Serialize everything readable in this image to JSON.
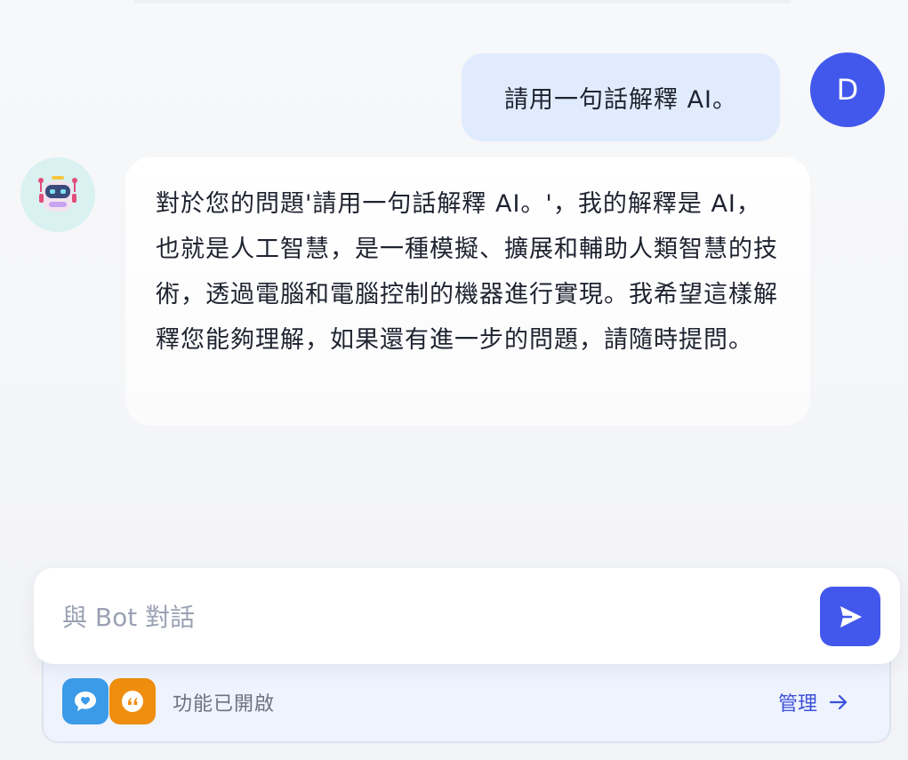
{
  "conversation": {
    "user_message": {
      "text": "請用一句話解釋 AI。",
      "avatar_initial": "D",
      "avatar_color": "#4258ec"
    },
    "bot_message": {
      "text": "對於您的問題'請用一句話解釋 AI。'，我的解釋是 AI，也就是人工智慧，是一種模擬、擴展和輔助人類智慧的技術，透過電腦和電腦控制的機器進行實現。我希望這樣解釋您能夠理解，如果還有進一步的問題，請隨時提問。",
      "avatar_icon": "robot-icon"
    }
  },
  "composer": {
    "placeholder": "與 Bot 對話",
    "value": "",
    "send_icon": "send-icon",
    "accent_color": "#4258ec"
  },
  "features": {
    "icons": [
      "chat-heart-icon",
      "quote-icon"
    ],
    "icon_colors": [
      "#3c9be8",
      "#ee8d0e"
    ],
    "status_text": "功能已開啟",
    "manage_label": "管理",
    "manage_icon": "arrow-right-icon"
  }
}
